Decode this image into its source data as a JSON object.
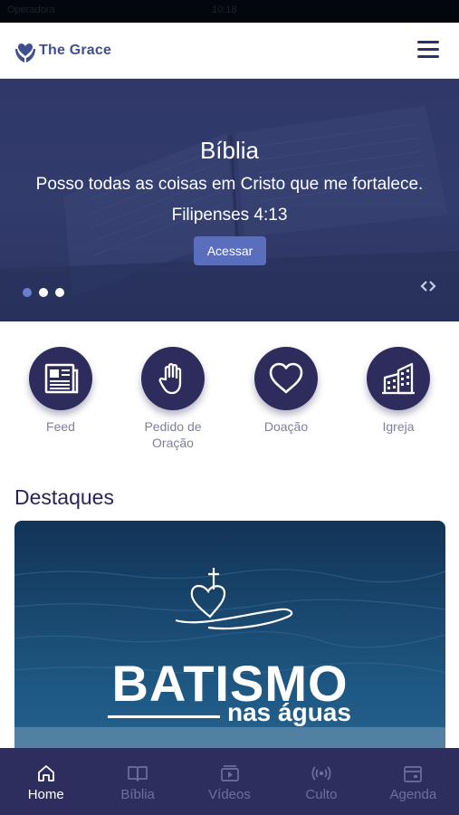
{
  "status_bar": {
    "carrier": "Operadora",
    "time": "10:18"
  },
  "header": {
    "logo_text": "The Grace",
    "menu_icon": "hamburger-menu-icon"
  },
  "banner": {
    "title": "Bíblia",
    "verse": "Posso todas as coisas em Cristo que me fortalece.",
    "reference": "Filipenses 4:13",
    "button_label": "Acessar",
    "slide_count": 3,
    "active_slide": 1
  },
  "shortcuts": [
    {
      "label": "Feed",
      "icon": "newspaper-icon"
    },
    {
      "label": "Pedido de\nOração",
      "icon": "raised-hand-icon"
    },
    {
      "label": "Doação",
      "icon": "heart-icon"
    },
    {
      "label": "Igreja",
      "icon": "buildings-icon"
    }
  ],
  "highlights": {
    "title": "Destaques",
    "card": {
      "title": "BATISMO",
      "subtitle": "nas águas"
    }
  },
  "tabs": [
    {
      "label": "Home",
      "icon": "home-icon",
      "active": true
    },
    {
      "label": "Bíblia",
      "icon": "book-icon",
      "active": false
    },
    {
      "label": "Vídeos",
      "icon": "video-icon",
      "active": false
    },
    {
      "label": "Culto",
      "icon": "broadcast-icon",
      "active": false
    },
    {
      "label": "Agenda",
      "icon": "calendar-icon",
      "active": false
    }
  ],
  "colors": {
    "primary": "#2e2c5c",
    "accent": "#5a6ebd",
    "tab_bar": "#2e2e5e",
    "banner": "#323c6c"
  }
}
